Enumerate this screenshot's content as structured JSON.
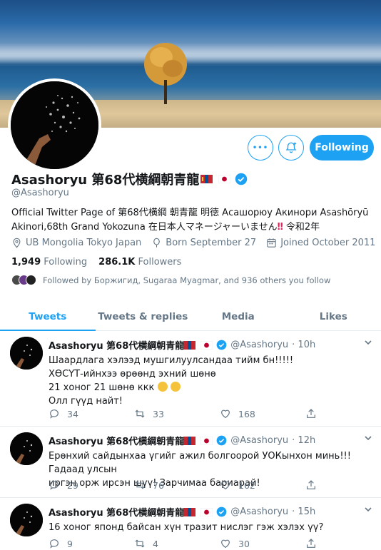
{
  "profile": {
    "name": "Asashoryu 第68代横綱朝青龍",
    "handle": "@Asashoryu",
    "bio_line1": "Official Twitter Page of 第68代横綱 朝青龍 明徳 Асашорюу Акинори Asashōryū",
    "bio_line2": "Akinori,68th Grand Yokozuna 在日本人マネージャーいません",
    "bio_line2_tail": " 令和2年",
    "location": "UB Mongolia Tokyo Japan",
    "born": "Born September 27",
    "joined": "Joined October 2011",
    "following_count": "1,949",
    "following_label": "Following",
    "followers_count": "286.1K",
    "followers_label": "Followers",
    "followed_by": "Followed by Боржигид, Sugaraa Myagmar, and 936 others you follow"
  },
  "buttons": {
    "more": "•••",
    "follow": "Following"
  },
  "tabs": [
    "Tweets",
    "Tweets & replies",
    "Media",
    "Likes"
  ],
  "tweets": [
    {
      "name": "Asashoryu 第68代横綱朝青龍",
      "handle": "@Asashoryu",
      "time": "· 10h",
      "lines": [
        "Шаардлага хэлээд мушгилуулсандаа тийм бн!!!!!",
        "ХӨСҮТ-ийнхээ өрөөнд эхний шөнө",
        "21 хоног 21 шөнө ккк",
        "Олл гүүд найт!"
      ],
      "replies": "34",
      "retweets": "33",
      "likes": "168"
    },
    {
      "name": "Asashoryu 第68代横綱朝青龍",
      "handle": "@Asashoryu",
      "time": "· 12h",
      "lines": [
        "Ерөнхий сайдынхаа үгийг ажил болгоорой УОКынхон минь!!!Гадаад  улсын",
        "иргэн орж ирсэн шүү! Зарчимаа бариарай!"
      ],
      "replies": "29",
      "retweets": "76",
      "likes": "162"
    },
    {
      "name": "Asashoryu 第68代横綱朝青龍",
      "handle": "@Asashoryu",
      "time": "· 15h",
      "lines": [
        "16 хоног японд байсан хүн тразит нислэг гэж хэлэх үү?"
      ],
      "replies": "9",
      "retweets": "4",
      "likes": "30"
    }
  ],
  "colors": {
    "accent": "#1da1f2",
    "muted": "#657786",
    "text": "#14171a",
    "alert": "#e0245e"
  }
}
